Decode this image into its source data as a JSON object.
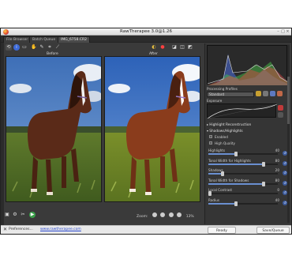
{
  "window": {
    "title": "RawTherapee 3.0@1.26"
  },
  "tabs": [
    {
      "label": "File Browser"
    },
    {
      "label": "Batch Queue"
    },
    {
      "label": "IMG_6758.CR2"
    }
  ],
  "preview": {
    "before_label": "Before",
    "after_label": "After"
  },
  "zoom": {
    "label": "Zoom:",
    "value": "13%"
  },
  "status": {
    "prefs_label": "Preferences...",
    "link_text": "www.rawtherapee.com",
    "ready_label": "Ready",
    "queue_label": "Save/Queue"
  },
  "right_panel": {
    "profile_title": "Processing Profiles",
    "profile_value": "Standard",
    "curve_section": "Exposure",
    "highlight_section": "Highlight Reconstruction",
    "sh_section": "Shadows/Highlights",
    "enabled_label": "Enabled",
    "hq_label": "High Quality",
    "sliders": [
      {
        "label": "Highlights",
        "value": "40",
        "fraction": 0.4
      },
      {
        "label": "Tonal Width for Highlights",
        "value": "80",
        "fraction": 0.8
      },
      {
        "label": "Shadows",
        "value": "20",
        "fraction": 0.2
      },
      {
        "label": "Tonal Width for Shadows",
        "value": "80",
        "fraction": 0.8
      },
      {
        "label": "Local Contrast",
        "value": "0",
        "fraction": 0.0
      },
      {
        "label": "Radius",
        "value": "40",
        "fraction": 0.4
      }
    ]
  },
  "colors": {
    "accent": "#3c5b9d",
    "histogram_red": "#e04848",
    "histogram_green": "#48c048",
    "histogram_blue": "#4a6ee0"
  }
}
